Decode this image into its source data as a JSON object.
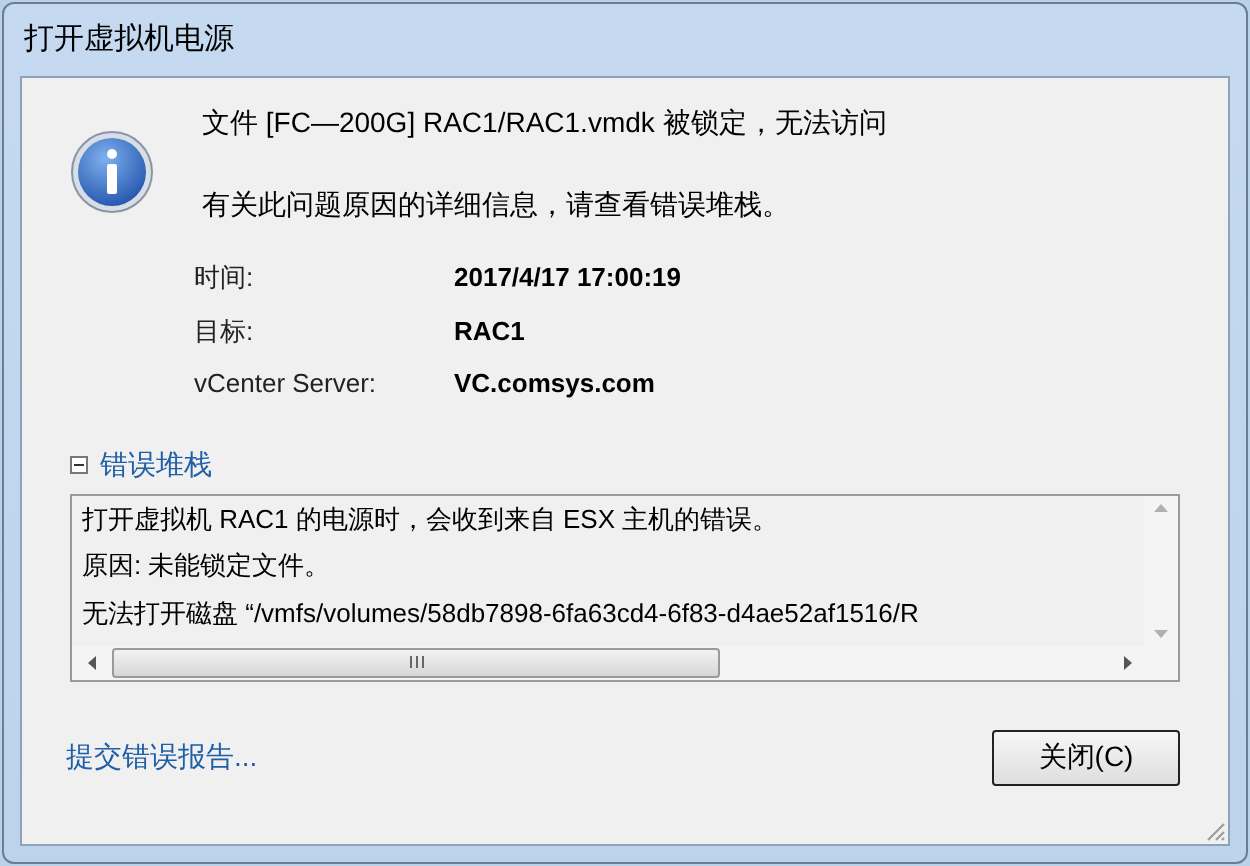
{
  "window": {
    "title": "打开虚拟机电源"
  },
  "message": {
    "headline": "文件 [FC—200G] RAC1/RAC1.vmdk 被锁定，无法访问",
    "detail": "有关此问题原因的详细信息，请查看错误堆栈。"
  },
  "details": [
    {
      "label": "时间:",
      "value": "2017/4/17 17:00:19"
    },
    {
      "label": "目标:",
      "value": "RAC1"
    },
    {
      "label": "vCenter Server:",
      "value": "VC.comsys.com"
    }
  ],
  "error_stack": {
    "title": "错误堆栈",
    "expanded": true,
    "lines": [
      "打开虚拟机 RAC1 的电源时，会收到来自 ESX 主机的错误。",
      "原因: 未能锁定文件。",
      "无法打开磁盘 “/vmfs/volumes/58db7898-6fa63cd4-6f83-d4ae52af1516/R"
    ]
  },
  "report_link": "提交错误报告...",
  "buttons": [
    "关闭(C)"
  ]
}
